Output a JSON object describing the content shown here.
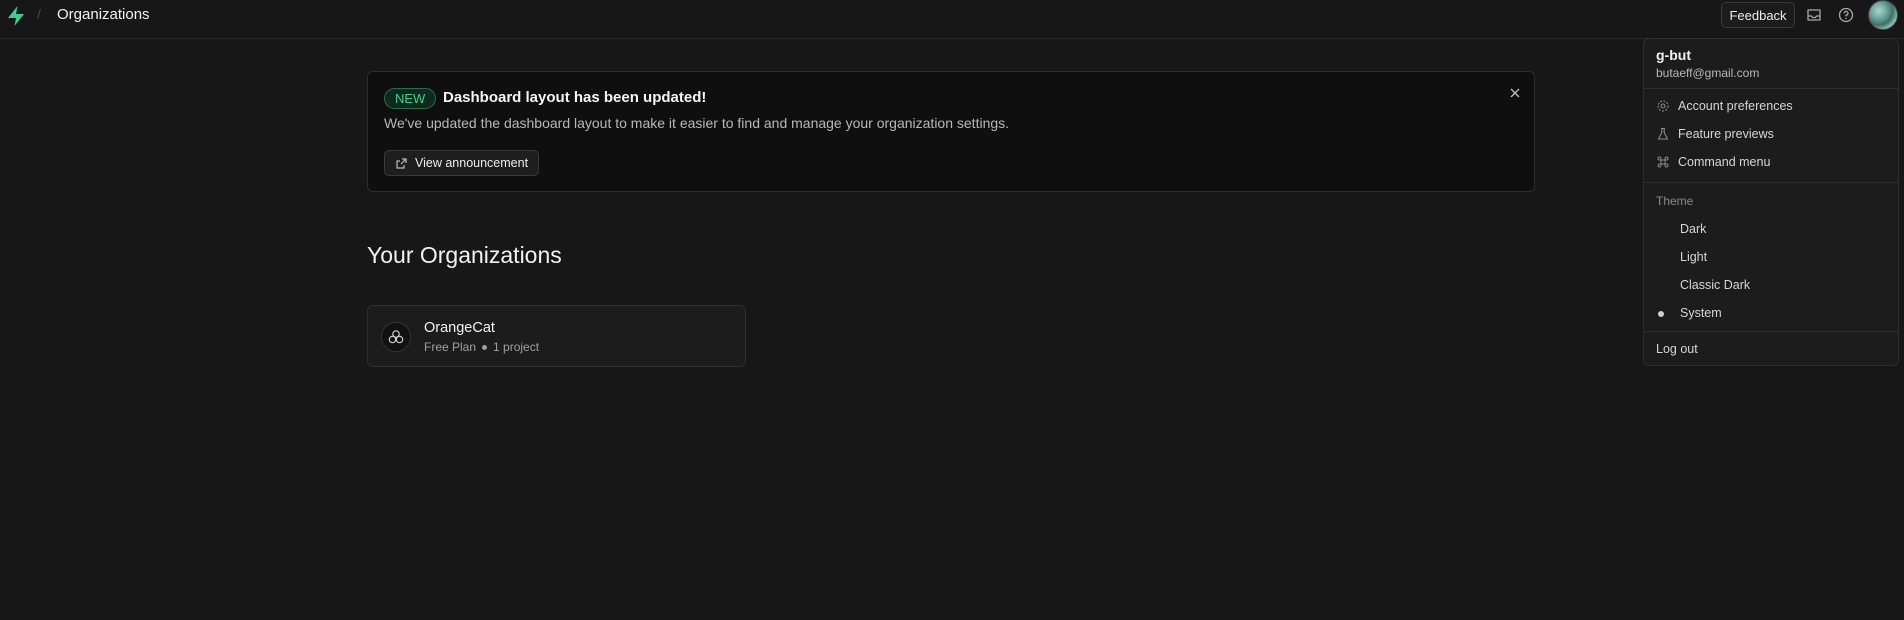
{
  "topbar": {
    "breadcrumb_separator": "/",
    "title": "Organizations",
    "feedback_label": "Feedback",
    "icons": [
      "inbox-icon",
      "help-icon"
    ]
  },
  "banner": {
    "badge": "NEW",
    "title": "Dashboard layout has been updated!",
    "description": "We've updated the dashboard layout to make it easier to find and manage your organization settings.",
    "button_label": "View announcement"
  },
  "main": {
    "section_title": "Your Organizations",
    "organizations": [
      {
        "name": "OrangeCat",
        "plan": "Free Plan",
        "projects": "1 project"
      }
    ]
  },
  "user_menu": {
    "username": "g-but",
    "email": "butaeff@gmail.com",
    "items": [
      {
        "label": "Account preferences",
        "icon": "gear-icon"
      },
      {
        "label": "Feature previews",
        "icon": "flask-icon"
      },
      {
        "label": "Command menu",
        "icon": "command-icon"
      }
    ],
    "theme_label": "Theme",
    "themes": [
      "Dark",
      "Light",
      "Classic Dark",
      "System"
    ],
    "selected_theme": "System",
    "logout_label": "Log out"
  },
  "colors": {
    "background": "#171717",
    "accent": "#3ecf8e",
    "panel": "#1c1c1c"
  }
}
